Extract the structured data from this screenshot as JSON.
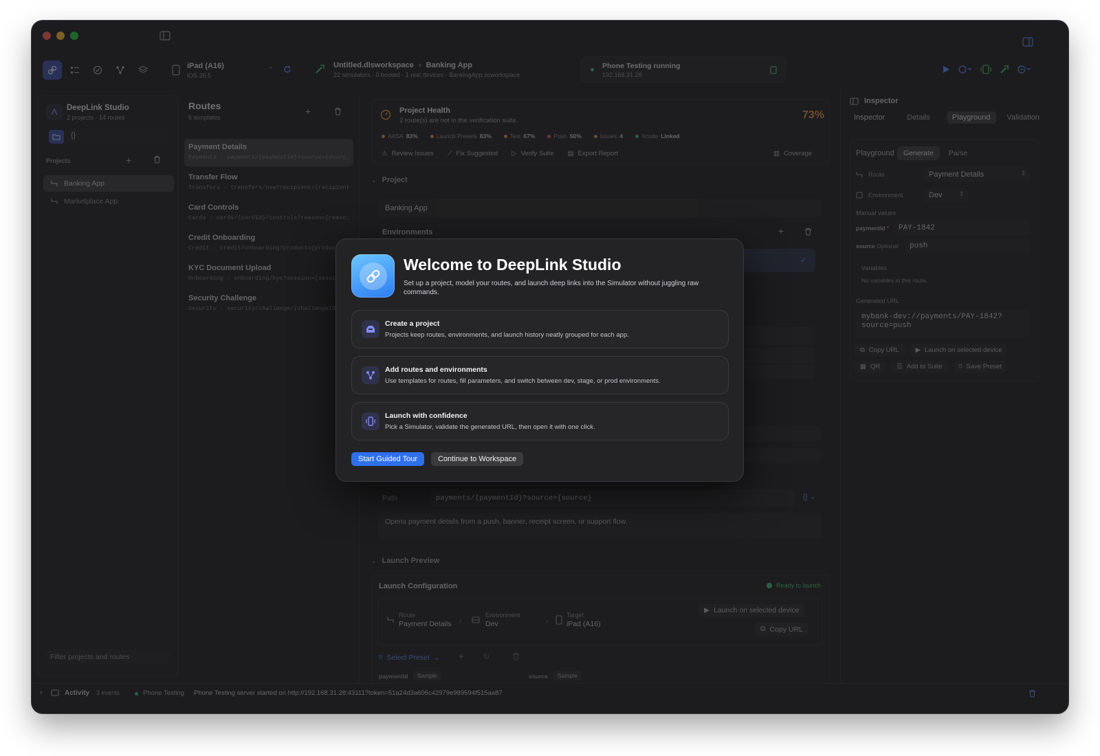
{
  "toolbar": {
    "device_name": "iPad (A16)",
    "device_os": "iOS 26.5",
    "workspace_name": "Untitled.dlsworkspace",
    "project_name": "Banking App",
    "workspace_meta": [
      "22 simulators",
      "0 booted",
      "1 real devices",
      "BankingApp.xcworkspace"
    ],
    "phone_status": "Phone Testing running",
    "phone_ip": "192.168.31.28"
  },
  "sidebar": {
    "app_name": "DeepLink Studio",
    "app_meta": "2 projects · 14 routes",
    "braces": "{}",
    "projects_label": "Projects",
    "projects": [
      "Banking App",
      "Marketplace App"
    ],
    "filter_placeholder": "Filter projects and routes"
  },
  "routes": {
    "title": "Routes",
    "count": "6 templates",
    "items": [
      {
        "title": "Payment Details",
        "sub": "Payments · payments/{paymentId}?source={sourc…"
      },
      {
        "title": "Transfer Flow",
        "sub": "Transfers · transfers/new?recipient={recipientI…"
      },
      {
        "title": "Card Controls",
        "sub": "Cards · cards/{cardId}/controls?reason={reaso…"
      },
      {
        "title": "Credit Onboarding",
        "sub": "Credit · credit/onboarding?product={product}…"
      },
      {
        "title": "KYC Document Upload",
        "sub": "Onboarding · onboarding/kyc?session={sessio…"
      },
      {
        "title": "Security Challenge",
        "sub": "Security · security/challenge/{challengeId}?…"
      }
    ]
  },
  "health": {
    "title": "Project Health",
    "subtitle": "2 route(s) are not in the verification suite.",
    "percent": "73%",
    "chips": [
      {
        "label": "AASA",
        "value": "83%",
        "color": "#e0913b"
      },
      {
        "label": "Launch Presets",
        "value": "83%",
        "color": "#e0913b"
      },
      {
        "label": "Test",
        "value": "67%",
        "color": "#e0913b"
      },
      {
        "label": "Push",
        "value": "50%",
        "color": "#e05656"
      },
      {
        "label": "Issues",
        "value": "4",
        "color": "#e0913b"
      },
      {
        "label": "Xcode",
        "value": "Linked",
        "color": "#3ec46d"
      }
    ],
    "actions": [
      "Review Issues",
      "Fix Suggested",
      "Verify Suite",
      "Export Report"
    ],
    "coverage": "Coverage"
  },
  "project": {
    "section": "Project",
    "name": "Banking App",
    "environments_label": "Environments",
    "path_label": "Path",
    "path_value": "payments/{paymentId}?source={source}",
    "description": "Opens payment details from a push, banner, receipt screen, or support flow."
  },
  "launch": {
    "section": "Launch Preview",
    "config_title": "Launch Configuration",
    "ready": "Ready to launch",
    "route_label": "Route",
    "route_value": "Payment Details",
    "env_label": "Environment",
    "env_value": "Dev",
    "target_label": "Target",
    "target_value": "iPad (A16)",
    "launch_btn": "Launch on selected device",
    "copy_btn": "Copy URL",
    "preset": "Select Preset",
    "param1": "paymentId",
    "param2": "source",
    "sample": "Sample"
  },
  "inspector": {
    "title": "Inspector",
    "tabs": [
      "Inspector",
      "Details",
      "Playground",
      "Validation"
    ],
    "active_tab": "Playground",
    "pg_label": "Playground",
    "pg_tabs": [
      "Generate",
      "Parse"
    ],
    "route_label": "Route",
    "route_value": "Payment Details",
    "env_label": "Environment",
    "env_value": "Dev",
    "manual_label": "Manual values",
    "p1_name": "paymentId",
    "p1_req": "*",
    "p1_value": "PAY-1842",
    "p2_name": "source",
    "p2_opt": "Optional",
    "p2_value": "push",
    "vars_label": "Variables",
    "vars_empty": "No variables in this route.",
    "gen_label": "Generated URL",
    "gen_url": "mybank-dev://payments/PAY-1842?\nsource=push",
    "btns": [
      "Copy URL",
      "Launch on selected device",
      "QR",
      "Add to Suite",
      "Save Preset"
    ]
  },
  "status": {
    "activity": "Activity",
    "events": "3 events",
    "phone": "Phone Testing",
    "message": "Phone Testing server started on http://192.168.31.28:43111?token=51a24d3a606c42979e989594f515aa87"
  },
  "modal": {
    "title": "Welcome to DeepLink Studio",
    "subtitle": "Set up a project, model your routes, and launch deep links into the Simulator without juggling raw commands.",
    "cards": [
      {
        "title": "Create a project",
        "desc": "Projects keep routes, environments, and launch history neatly grouped for each app.",
        "icon": "tray-icon"
      },
      {
        "title": "Add routes and environments",
        "desc": "Use templates for routes, fill parameters, and switch between dev, stage, or prod environments.",
        "icon": "branch-icon"
      },
      {
        "title": "Launch with confidence",
        "desc": "Pick a Simulator, validate the generated URL, then open it with one click.",
        "icon": "device-icon"
      }
    ],
    "primary_btn": "Start Guided Tour",
    "secondary_btn": "Continue to Workspace"
  },
  "colors": {
    "accent": "#3478f6",
    "warning": "#e0913b",
    "success": "#3ec46d",
    "window": "#1c1c1e"
  }
}
